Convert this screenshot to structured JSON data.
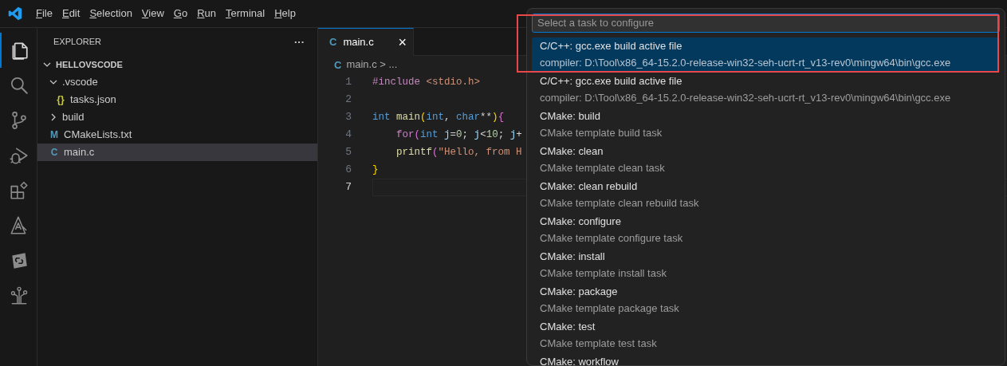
{
  "menu": [
    "File",
    "Edit",
    "Selection",
    "View",
    "Go",
    "Run",
    "Terminal",
    "Help"
  ],
  "activity_bar": [
    {
      "kind": "files",
      "selected": true
    },
    {
      "kind": "search",
      "selected": false
    },
    {
      "kind": "branch",
      "selected": false
    },
    {
      "kind": "debug",
      "selected": false
    },
    {
      "kind": "blocks",
      "selected": false
    },
    {
      "kind": "triangle",
      "selected": false
    },
    {
      "kind": "link",
      "selected": false
    },
    {
      "kind": "tree",
      "selected": false
    }
  ],
  "explorer": {
    "title": "EXPLORER",
    "more": "···",
    "tree": [
      {
        "label": "HELLOVSCODE",
        "kind": "root",
        "expanded": true,
        "selected": false,
        "children": [
          {
            "label": ".vscode",
            "kind": "folder",
            "expanded": true,
            "selected": false,
            "children": [
              {
                "label": "tasks.json",
                "kind": "json",
                "icon": "{}",
                "selected": false
              }
            ]
          },
          {
            "label": "build",
            "kind": "folder",
            "expanded": false,
            "selected": false
          },
          {
            "label": "CMakeLists.txt",
            "kind": "cmake",
            "icon": "M",
            "selected": false
          },
          {
            "label": "main.c",
            "kind": "c",
            "icon": "C",
            "selected": true
          }
        ]
      }
    ]
  },
  "editor": {
    "tabs": [
      {
        "icon": "C",
        "label": "main.c",
        "selected": true,
        "close": "×"
      }
    ],
    "breadcrumb_icon": "C",
    "breadcrumb": "main.c > ...",
    "lines": [
      {
        "number": "1",
        "current": false,
        "tokens": [
          {
            "kind": "directive",
            "text": "#include"
          },
          {
            "kind": "string",
            "text": " <stdio.h>"
          }
        ]
      },
      {
        "number": "2",
        "current": false
      },
      {
        "number": "3",
        "current": false,
        "tokens": [
          {
            "kind": "type",
            "text": "int"
          },
          {
            "kind": "function",
            "text": " main"
          },
          {
            "kind": "bracket1",
            "text": "("
          },
          {
            "kind": "type",
            "text": "int"
          },
          {
            "kind": "plain",
            "text": ","
          },
          {
            "kind": "type",
            "text": " char"
          },
          {
            "kind": "plain",
            "text": "**"
          },
          {
            "kind": "bracket1",
            "text": ")"
          },
          {
            "kind": "bracket2",
            "text": "{"
          }
        ]
      },
      {
        "number": "4",
        "current": false,
        "tokens": [
          {
            "kind": "directive",
            "text": "    for"
          },
          {
            "kind": "bracket2",
            "text": "("
          },
          {
            "kind": "type",
            "text": "int"
          },
          {
            "kind": "variable",
            "text": " j"
          },
          {
            "kind": "plain",
            "text": "="
          },
          {
            "kind": "number",
            "text": "0"
          },
          {
            "kind": "plain",
            "text": ";"
          },
          {
            "kind": "variable",
            "text": " j"
          },
          {
            "kind": "plain",
            "text": "<"
          },
          {
            "kind": "number",
            "text": "10"
          },
          {
            "kind": "plain",
            "text": ";"
          },
          {
            "kind": "variable",
            "text": " j"
          },
          {
            "kind": "plain",
            "text": "+"
          }
        ]
      },
      {
        "number": "5",
        "current": false,
        "tokens": [
          {
            "kind": "function",
            "text": "    printf"
          },
          {
            "kind": "bracket2",
            "text": "("
          },
          {
            "kind": "string",
            "text": "\"Hello, from H"
          }
        ]
      },
      {
        "number": "6",
        "current": false,
        "tokens": [
          {
            "kind": "bracket1",
            "text": "}"
          }
        ]
      },
      {
        "number": "7",
        "current": true
      }
    ]
  },
  "quick_pick": {
    "placeholder": "Select a task to configure",
    "items": [
      {
        "label": "C/C++: gcc.exe build active file",
        "detail": "compiler: D:\\Tool\\x86_64-15.2.0-release-win32-seh-ucrt-rt_v13-rev0\\mingw64\\bin\\gcc.exe",
        "selected": true
      },
      {
        "label": "C/C++: gcc.exe build active file",
        "detail": "compiler: D:\\Tool\\x86_64-15.2.0-release-win32-seh-ucrt-rt_v13-rev0\\mingw64\\bin\\gcc.exe",
        "selected": false
      },
      {
        "label": "CMake: build",
        "detail": "CMake template build task",
        "selected": false
      },
      {
        "label": "CMake: clean",
        "detail": "CMake template clean task",
        "selected": false
      },
      {
        "label": "CMake: clean rebuild",
        "detail": "CMake template clean rebuild task",
        "selected": false
      },
      {
        "label": "CMake: configure",
        "detail": "CMake template configure task",
        "selected": false
      },
      {
        "label": "CMake: install",
        "detail": "CMake template install task",
        "selected": false
      },
      {
        "label": "CMake: package",
        "detail": "CMake template package task",
        "selected": false
      },
      {
        "label": "CMake: test",
        "detail": "CMake template test task",
        "selected": false
      },
      {
        "label": "CMake: workflow",
        "selected": false
      }
    ]
  }
}
